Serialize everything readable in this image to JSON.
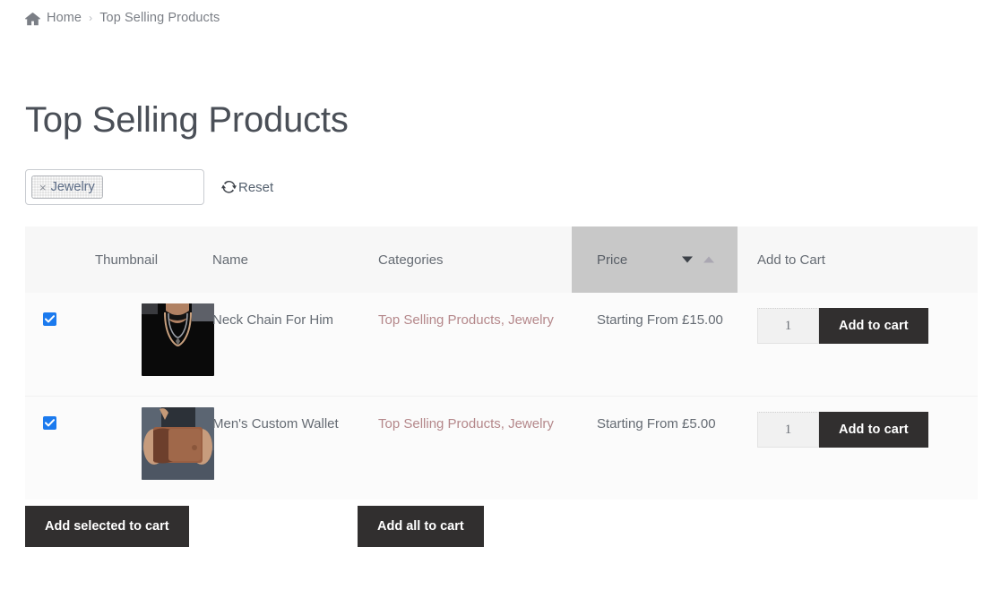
{
  "breadcrumb": {
    "home_icon": "home-icon",
    "home_label": "Home",
    "separator": "›",
    "current_label": "Top Selling Products"
  },
  "page_title": "Top Selling Products",
  "filter": {
    "tag_remove": "×",
    "tag_label": "Jewelry",
    "reset_label": "Reset",
    "reset_icon": "refresh-icon"
  },
  "table": {
    "headers": {
      "thumbnail": "Thumbnail",
      "name": "Name",
      "categories": "Categories",
      "price": "Price",
      "add_to_cart": "Add to Cart"
    },
    "sort": {
      "active_column": "Price",
      "desc_icon": "caret-down-icon",
      "asc_icon": "caret-up-icon"
    },
    "rows": [
      {
        "checked": true,
        "thumbnail_alt": "neck-chain-thumbnail",
        "name": "Neck Chain For Him",
        "categories": "Top Selling Products, Jewelry",
        "price": "Starting From £15.00",
        "qty": "1",
        "add_button": "Add to cart"
      },
      {
        "checked": true,
        "thumbnail_alt": "wallet-thumbnail",
        "name": "Men's Custom Wallet",
        "categories": "Top Selling Products, Jewelry",
        "price": "Starting From £5.00",
        "qty": "1",
        "add_button": "Add to cart"
      }
    ]
  },
  "bottom": {
    "add_selected": "Add selected to cart",
    "add_all": "Add all to cart"
  },
  "colors": {
    "button_dark": "#312f2f",
    "checkbox_blue": "#1b7aee",
    "header_bg": "#f7f7f7",
    "sorted_header_bg": "#c8c8c8",
    "category_link": "#b4878a"
  }
}
